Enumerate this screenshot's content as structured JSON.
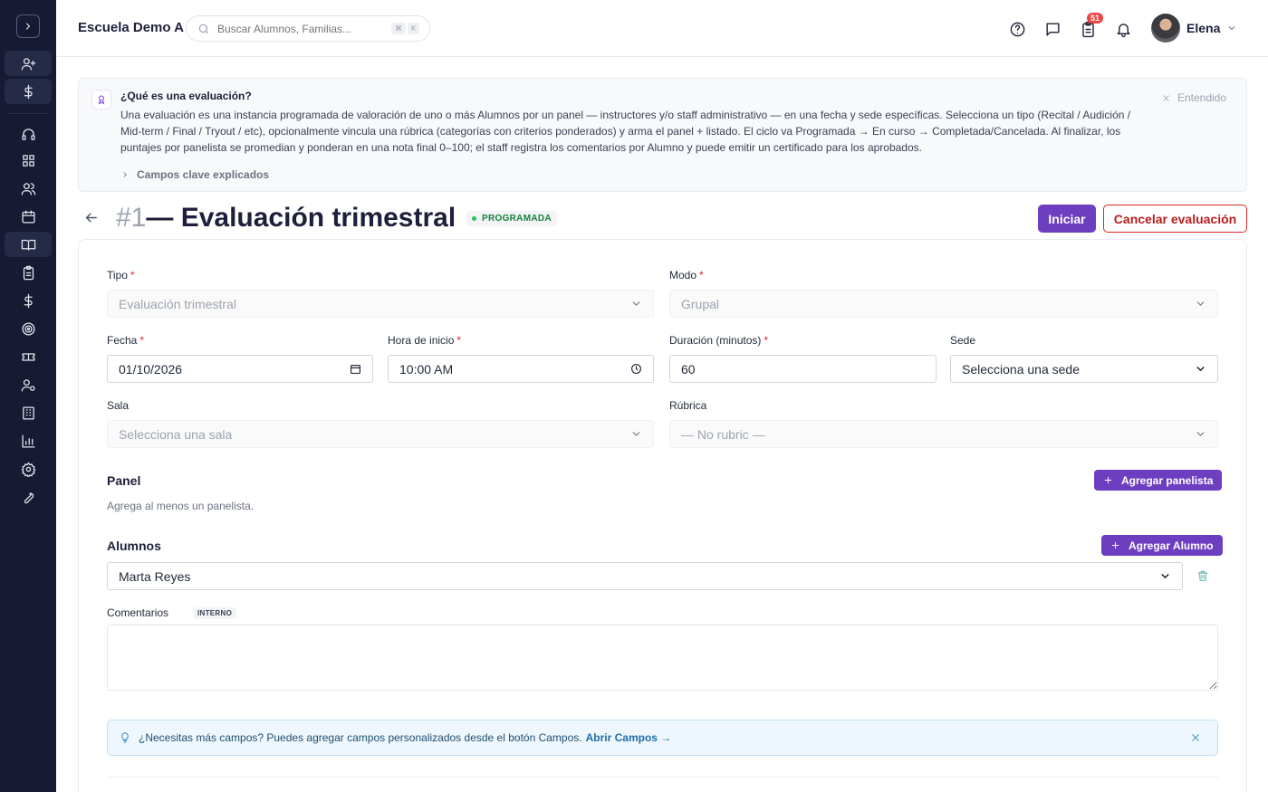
{
  "header": {
    "school": "Escuela Demo A",
    "search_placeholder": "Buscar Alumnos, Familias...",
    "kbd_1": "⌘",
    "kbd_2": "K",
    "notification_count": "51",
    "user_name": "Elena"
  },
  "info": {
    "title": "¿Qué es una evaluación?",
    "body": "Una evaluación es una instancia programada de valoración de uno o más Alumnos por un panel — instructores y/o staff administrativo — en una fecha y sede específicas. Selecciona un tipo (Recital / Audición / Mid-term / Final / Tryout / etc), opcionalmente vincula una rúbrica (categorías con criterios ponderados) y arma el panel + listado. El ciclo va Programada → En curso → Completada/Cancelada. Al finalizar, los puntajes por panelista se promedian y ponderan en una nota final 0–100; el staff registra los comentarios por Alumno y puede emitir un certificado para los aprobados.",
    "link": "Campos clave explicados",
    "dismiss": "Entendido"
  },
  "page": {
    "number": "#1",
    "title": "— Evaluación trimestral",
    "status": "PROGRAMADA",
    "start_button": "Iniciar",
    "cancel_button": "Cancelar evaluación"
  },
  "form": {
    "tipo_label": "Tipo",
    "tipo_value": "Evaluación trimestral",
    "modo_label": "Modo",
    "modo_value": "Grupal",
    "fecha_label": "Fecha",
    "fecha_value": "01/10/2026",
    "hora_label": "Hora de inicio",
    "hora_value": "10:00  AM",
    "duracion_label": "Duración (minutos)",
    "duracion_value": "60",
    "sede_label": "Sede",
    "sede_value": "Selecciona una sede",
    "sala_label": "Sala",
    "sala_value": "Selecciona una sala",
    "rubrica_label": "Rúbrica",
    "rubrica_value": "— No rubric —",
    "required_mark": "*"
  },
  "panel": {
    "title": "Panel",
    "empty": "Agrega al menos un panelista.",
    "add_button": "Agregar panelista"
  },
  "alumnos": {
    "title": "Alumnos",
    "add_button": "Agregar Alumno",
    "selected": "Marta Reyes"
  },
  "comentarios": {
    "label": "Comentarios",
    "tag": "INTERNO"
  },
  "tip": {
    "message": "¿Necesitas más campos? Puedes agregar campos personalizados desde el botón Campos.",
    "link": "Abrir Campos →"
  },
  "colors": {
    "sidebar": "#161a33",
    "accent": "#6d3fc0",
    "danger": "#dc2626",
    "status_green": "#22c55e"
  }
}
